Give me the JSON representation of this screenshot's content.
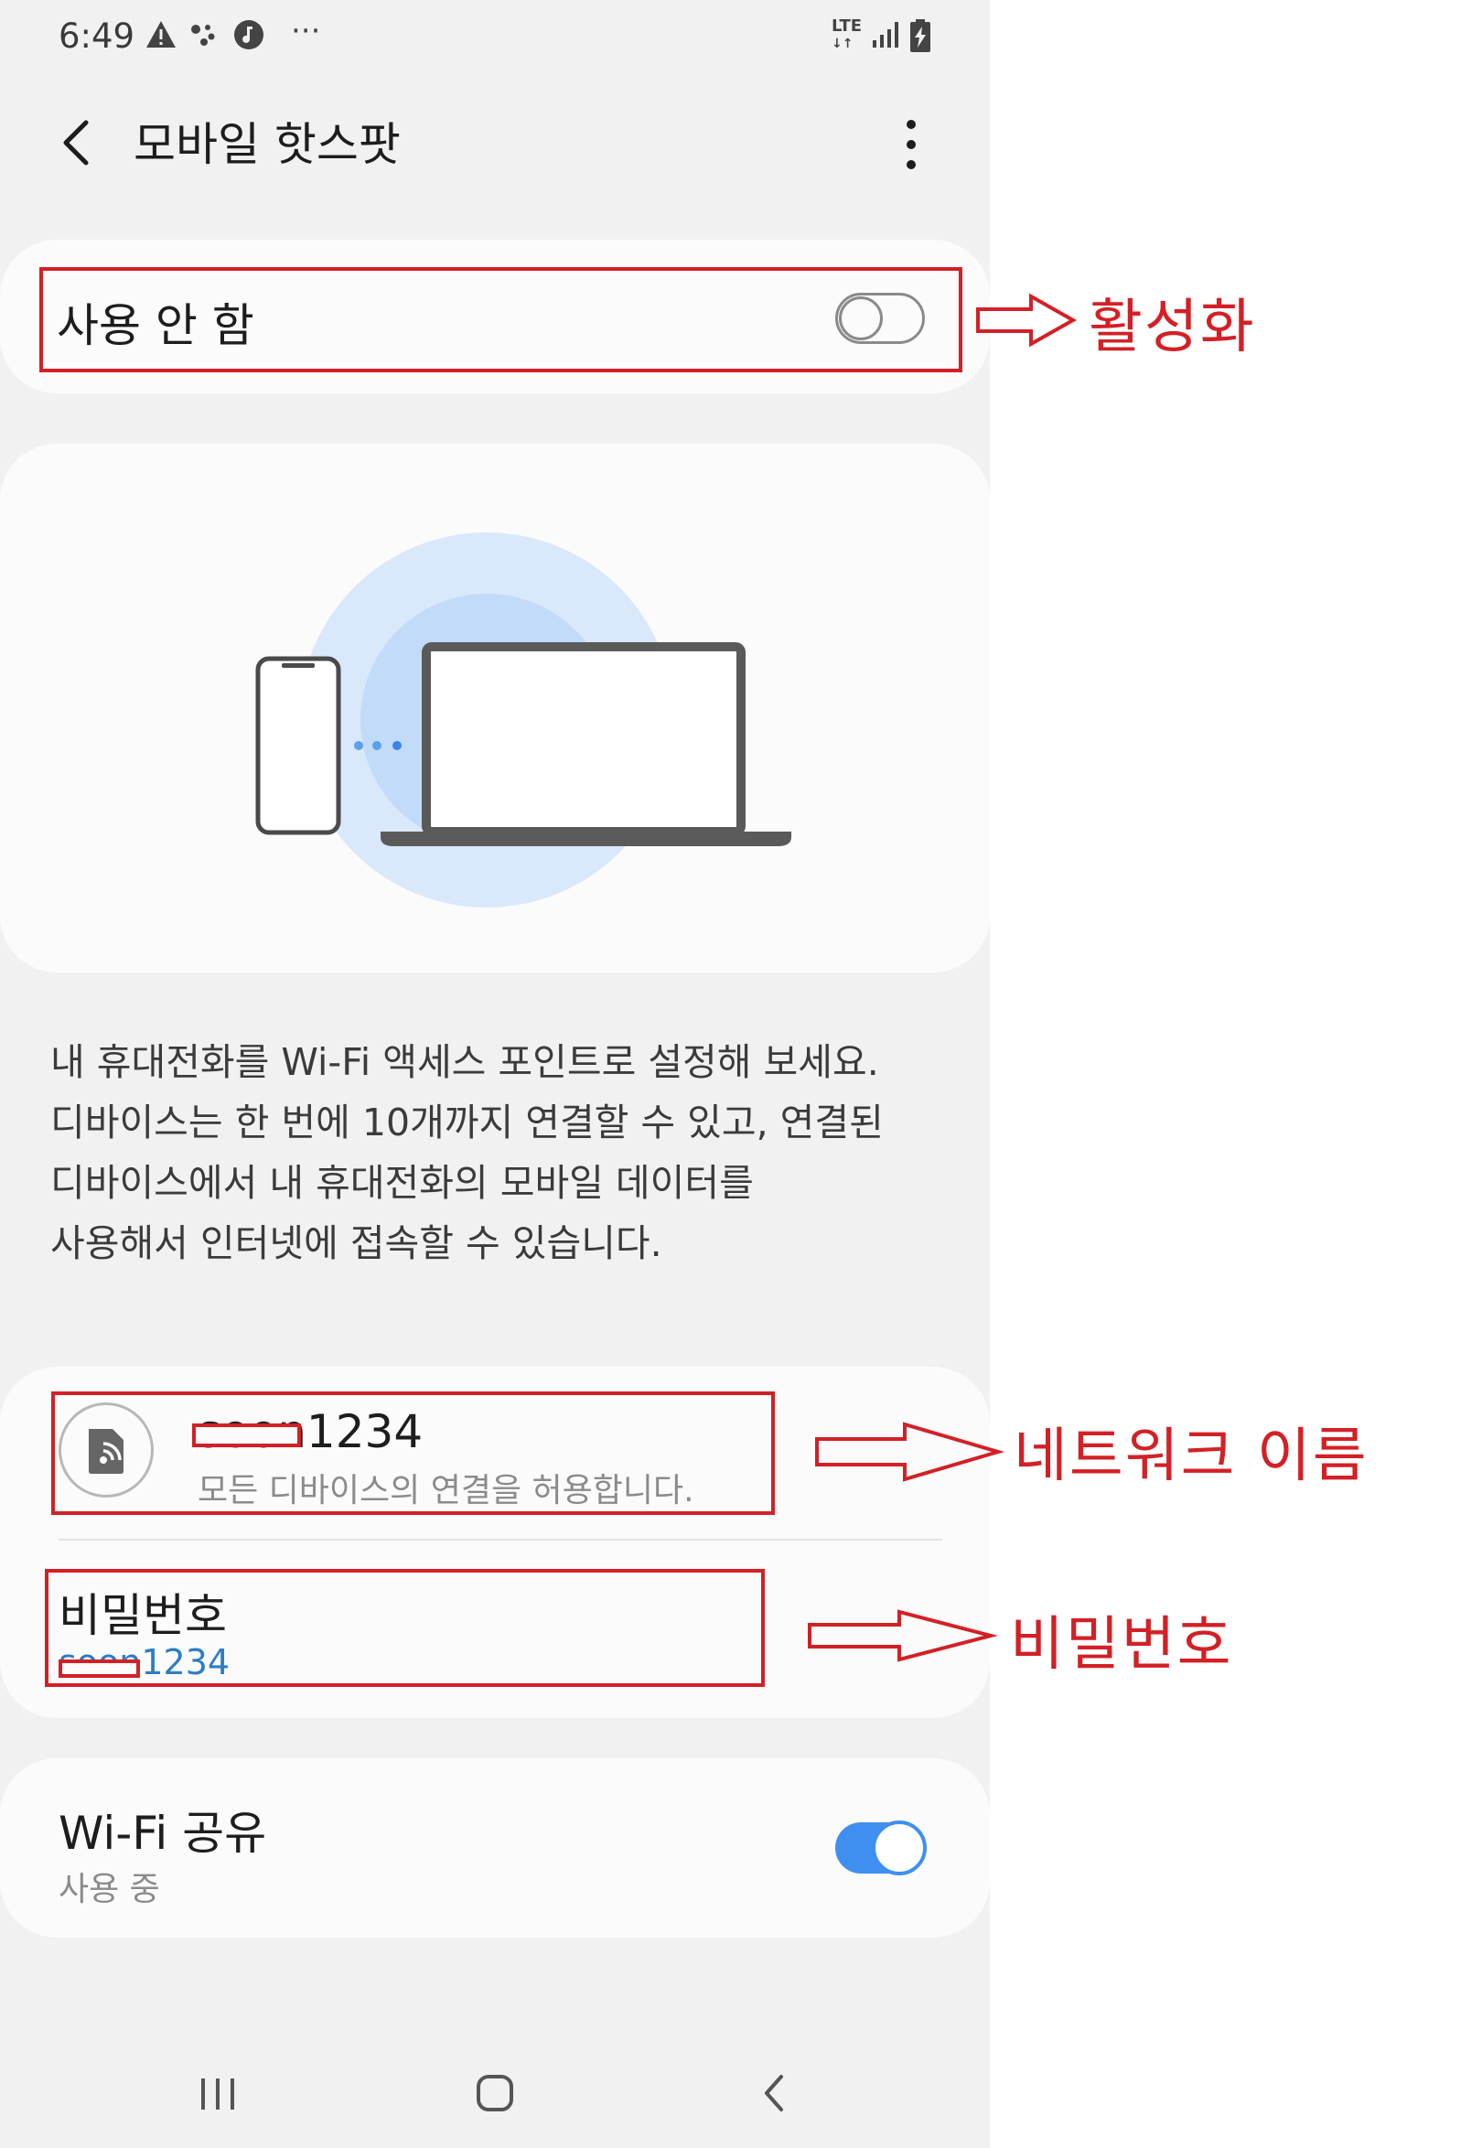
{
  "status_bar": {
    "time": "6:49",
    "left_icons": [
      "warning-icon",
      "assistant-icon",
      "music-icon",
      "more-notifications-icon"
    ],
    "right_icons": [
      "lte-icon",
      "signal-icon",
      "battery-charging-icon"
    ],
    "lte": "LTE",
    "more": "···"
  },
  "header": {
    "title": "모바일 핫스팟"
  },
  "hotspot_toggle": {
    "label": "사용 안 함",
    "enabled": false
  },
  "description": "내 휴대전화를 Wi-Fi 액세스 포인트로 설정해 보세요.\n디바이스는 한 번에 10개까지 연결할 수 있고, 연결된\n디바이스에서 내 휴대전화의 모바일 데이터를\n사용해서 인터넷에 접속할 수 있습니다.",
  "network": {
    "name": "soon1234",
    "subtitle": "모든 디바이스의 연결을 허용합니다."
  },
  "password": {
    "label": "비밀번호",
    "value": "soon1234"
  },
  "wifi_sharing": {
    "title": "Wi-Fi 공유",
    "status": "사용 중",
    "enabled": true
  },
  "annotations": {
    "activate": "활성화",
    "network_name": "네트워크 이름",
    "password": "비밀번호"
  },
  "colors": {
    "annotation_red": "#d32026",
    "accent_blue": "#3e8ff0",
    "link_blue": "#2c7dc5",
    "background": "#f1f1f1",
    "card": "#fbfbfb"
  }
}
